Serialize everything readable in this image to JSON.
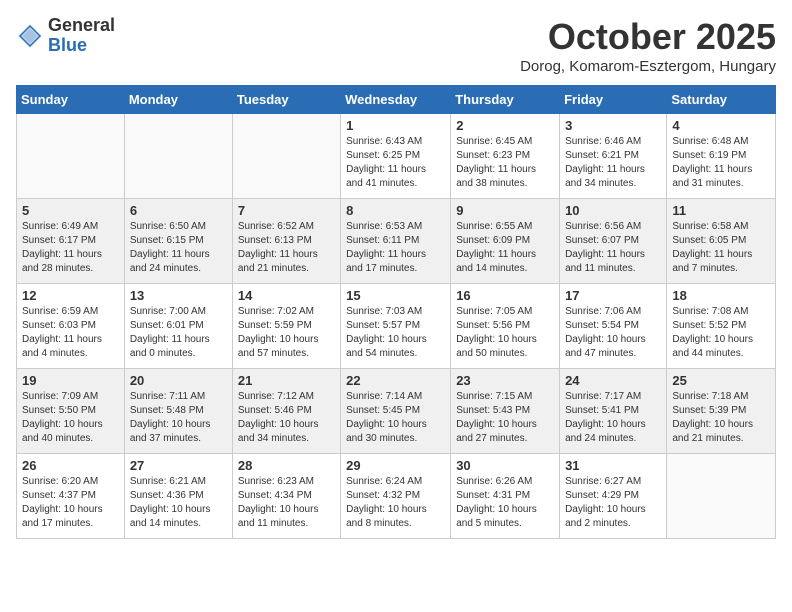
{
  "header": {
    "logo_line1": "General",
    "logo_line2": "Blue",
    "month_title": "October 2025",
    "location": "Dorog, Komarom-Esztergom, Hungary"
  },
  "weekdays": [
    "Sunday",
    "Monday",
    "Tuesday",
    "Wednesday",
    "Thursday",
    "Friday",
    "Saturday"
  ],
  "weeks": [
    [
      {
        "day": "",
        "info": ""
      },
      {
        "day": "",
        "info": ""
      },
      {
        "day": "",
        "info": ""
      },
      {
        "day": "1",
        "info": "Sunrise: 6:43 AM\nSunset: 6:25 PM\nDaylight: 11 hours\nand 41 minutes."
      },
      {
        "day": "2",
        "info": "Sunrise: 6:45 AM\nSunset: 6:23 PM\nDaylight: 11 hours\nand 38 minutes."
      },
      {
        "day": "3",
        "info": "Sunrise: 6:46 AM\nSunset: 6:21 PM\nDaylight: 11 hours\nand 34 minutes."
      },
      {
        "day": "4",
        "info": "Sunrise: 6:48 AM\nSunset: 6:19 PM\nDaylight: 11 hours\nand 31 minutes."
      }
    ],
    [
      {
        "day": "5",
        "info": "Sunrise: 6:49 AM\nSunset: 6:17 PM\nDaylight: 11 hours\nand 28 minutes."
      },
      {
        "day": "6",
        "info": "Sunrise: 6:50 AM\nSunset: 6:15 PM\nDaylight: 11 hours\nand 24 minutes."
      },
      {
        "day": "7",
        "info": "Sunrise: 6:52 AM\nSunset: 6:13 PM\nDaylight: 11 hours\nand 21 minutes."
      },
      {
        "day": "8",
        "info": "Sunrise: 6:53 AM\nSunset: 6:11 PM\nDaylight: 11 hours\nand 17 minutes."
      },
      {
        "day": "9",
        "info": "Sunrise: 6:55 AM\nSunset: 6:09 PM\nDaylight: 11 hours\nand 14 minutes."
      },
      {
        "day": "10",
        "info": "Sunrise: 6:56 AM\nSunset: 6:07 PM\nDaylight: 11 hours\nand 11 minutes."
      },
      {
        "day": "11",
        "info": "Sunrise: 6:58 AM\nSunset: 6:05 PM\nDaylight: 11 hours\nand 7 minutes."
      }
    ],
    [
      {
        "day": "12",
        "info": "Sunrise: 6:59 AM\nSunset: 6:03 PM\nDaylight: 11 hours\nand 4 minutes."
      },
      {
        "day": "13",
        "info": "Sunrise: 7:00 AM\nSunset: 6:01 PM\nDaylight: 11 hours\nand 0 minutes."
      },
      {
        "day": "14",
        "info": "Sunrise: 7:02 AM\nSunset: 5:59 PM\nDaylight: 10 hours\nand 57 minutes."
      },
      {
        "day": "15",
        "info": "Sunrise: 7:03 AM\nSunset: 5:57 PM\nDaylight: 10 hours\nand 54 minutes."
      },
      {
        "day": "16",
        "info": "Sunrise: 7:05 AM\nSunset: 5:56 PM\nDaylight: 10 hours\nand 50 minutes."
      },
      {
        "day": "17",
        "info": "Sunrise: 7:06 AM\nSunset: 5:54 PM\nDaylight: 10 hours\nand 47 minutes."
      },
      {
        "day": "18",
        "info": "Sunrise: 7:08 AM\nSunset: 5:52 PM\nDaylight: 10 hours\nand 44 minutes."
      }
    ],
    [
      {
        "day": "19",
        "info": "Sunrise: 7:09 AM\nSunset: 5:50 PM\nDaylight: 10 hours\nand 40 minutes."
      },
      {
        "day": "20",
        "info": "Sunrise: 7:11 AM\nSunset: 5:48 PM\nDaylight: 10 hours\nand 37 minutes."
      },
      {
        "day": "21",
        "info": "Sunrise: 7:12 AM\nSunset: 5:46 PM\nDaylight: 10 hours\nand 34 minutes."
      },
      {
        "day": "22",
        "info": "Sunrise: 7:14 AM\nSunset: 5:45 PM\nDaylight: 10 hours\nand 30 minutes."
      },
      {
        "day": "23",
        "info": "Sunrise: 7:15 AM\nSunset: 5:43 PM\nDaylight: 10 hours\nand 27 minutes."
      },
      {
        "day": "24",
        "info": "Sunrise: 7:17 AM\nSunset: 5:41 PM\nDaylight: 10 hours\nand 24 minutes."
      },
      {
        "day": "25",
        "info": "Sunrise: 7:18 AM\nSunset: 5:39 PM\nDaylight: 10 hours\nand 21 minutes."
      }
    ],
    [
      {
        "day": "26",
        "info": "Sunrise: 6:20 AM\nSunset: 4:37 PM\nDaylight: 10 hours\nand 17 minutes."
      },
      {
        "day": "27",
        "info": "Sunrise: 6:21 AM\nSunset: 4:36 PM\nDaylight: 10 hours\nand 14 minutes."
      },
      {
        "day": "28",
        "info": "Sunrise: 6:23 AM\nSunset: 4:34 PM\nDaylight: 10 hours\nand 11 minutes."
      },
      {
        "day": "29",
        "info": "Sunrise: 6:24 AM\nSunset: 4:32 PM\nDaylight: 10 hours\nand 8 minutes."
      },
      {
        "day": "30",
        "info": "Sunrise: 6:26 AM\nSunset: 4:31 PM\nDaylight: 10 hours\nand 5 minutes."
      },
      {
        "day": "31",
        "info": "Sunrise: 6:27 AM\nSunset: 4:29 PM\nDaylight: 10 hours\nand 2 minutes."
      },
      {
        "day": "",
        "info": ""
      }
    ]
  ]
}
